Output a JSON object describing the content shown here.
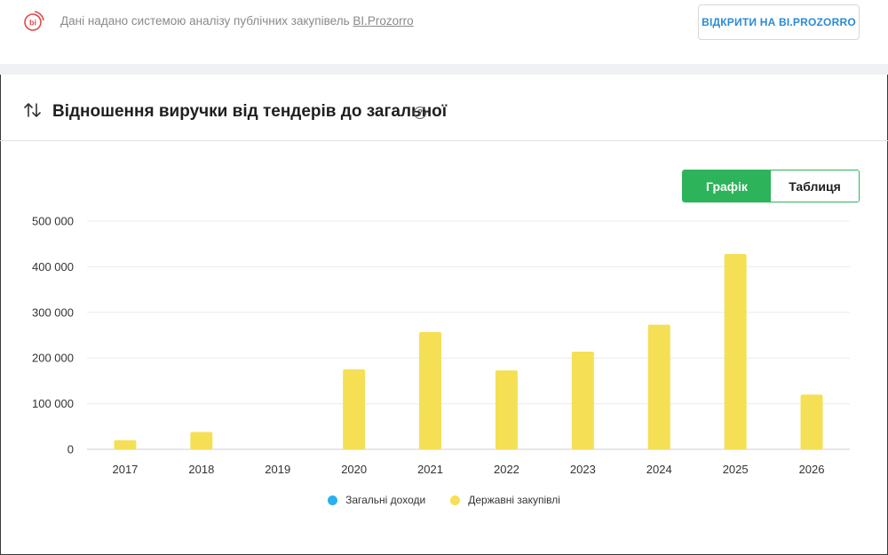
{
  "header": {
    "source_text": "Дані надано системою аналізу публічних закупівель ",
    "source_link": "BI.Prozorro",
    "open_button": "ВІДКРИТИ НА BI.PROZORRO",
    "logo_text": "bi"
  },
  "section": {
    "title": "Відношення виручки від тендерів до загальної",
    "help": "?"
  },
  "toggle": {
    "chart_label": "Графік",
    "table_label": "Таблиця"
  },
  "colors": {
    "accent_green": "#2db35a",
    "series_total": "#2ab0ef",
    "series_gov": "#f5df55",
    "link_blue": "#2a8ad4",
    "logo_red": "#e04a4a"
  },
  "chart_data": {
    "type": "bar",
    "categories": [
      "2017",
      "2018",
      "2019",
      "2020",
      "2021",
      "2022",
      "2023",
      "2024",
      "2025",
      "2026"
    ],
    "series": [
      {
        "name": "Загальні доходи",
        "values": [
          0,
          0,
          0,
          0,
          0,
          0,
          0,
          0,
          0,
          0
        ]
      },
      {
        "name": "Державні закупівлі",
        "values": [
          20000,
          38000,
          0,
          175000,
          257000,
          173000,
          214000,
          273000,
          428000,
          120000
        ]
      }
    ],
    "yticks": [
      0,
      100000,
      200000,
      300000,
      400000,
      500000
    ],
    "ytick_labels": [
      "0",
      "100 000",
      "200 000",
      "300 000",
      "400 000",
      "500 000"
    ],
    "ylim": [
      0,
      500000
    ],
    "grid": true,
    "legend": "bottom-center"
  }
}
